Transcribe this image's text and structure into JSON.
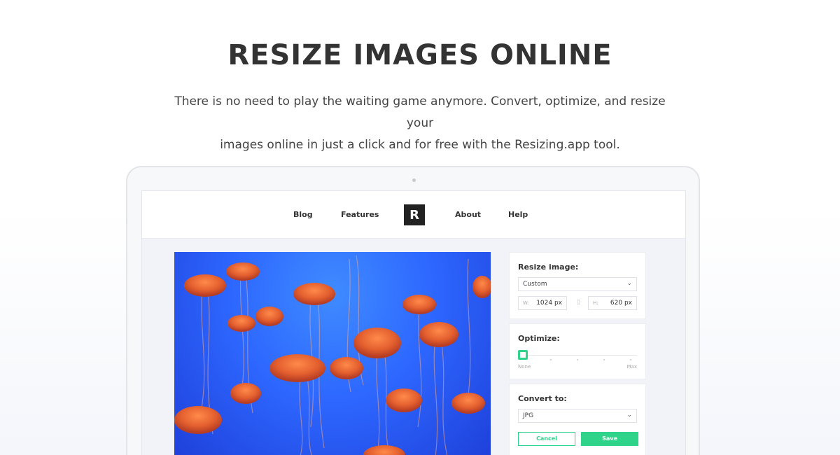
{
  "hero": {
    "title": "RESIZE IMAGES ONLINE",
    "subtitle_line1": "There is no need to play the waiting game anymore. Convert, optimize, and resize your",
    "subtitle_line2": "images online in just a click and for free with the Resizing.app tool."
  },
  "nav": {
    "items": [
      {
        "label": "Blog"
      },
      {
        "label": "Features"
      },
      {
        "label": "About"
      },
      {
        "label": "Help"
      }
    ],
    "logo_letter": "R"
  },
  "resize": {
    "title": "Resize image:",
    "preset": "Custom",
    "width_label": "W:",
    "width_value": "1024 px",
    "height_label": "H:",
    "height_value": "620 px"
  },
  "optimize": {
    "title": "Optimize:",
    "min_label": "None",
    "max_label": "Max",
    "level": 0
  },
  "convert": {
    "title": "Convert to:",
    "format": "JPG",
    "cancel_label": "Cancel",
    "save_label": "Save"
  },
  "colors": {
    "accent": "#2fd48a",
    "photo_blue": "#2d67ff",
    "jelly": "#e8673a"
  },
  "icons": {
    "dropdown": "chevron-down-icon",
    "lock": "link-lock-icon"
  }
}
